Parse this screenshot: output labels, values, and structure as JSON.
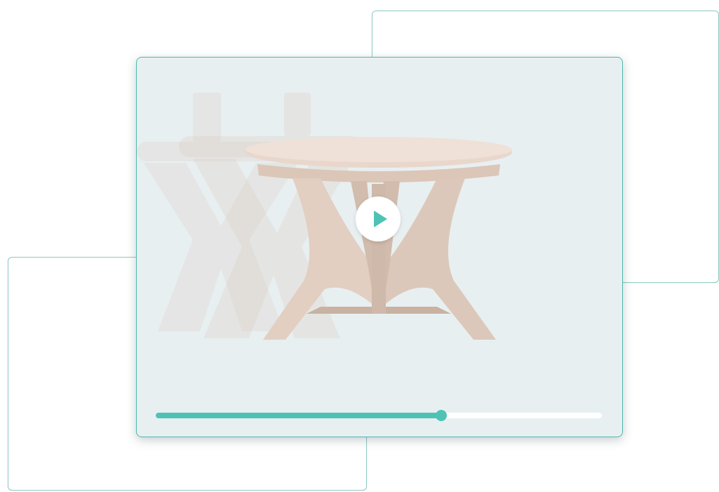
{
  "colors": {
    "accent": "#4ec3b5",
    "player_background": "#e8eff1",
    "card_border": "#8fc9c3",
    "wood": "#e6d3c7"
  },
  "player": {
    "progress": 0.64,
    "icons": {
      "play": "play-icon"
    }
  }
}
